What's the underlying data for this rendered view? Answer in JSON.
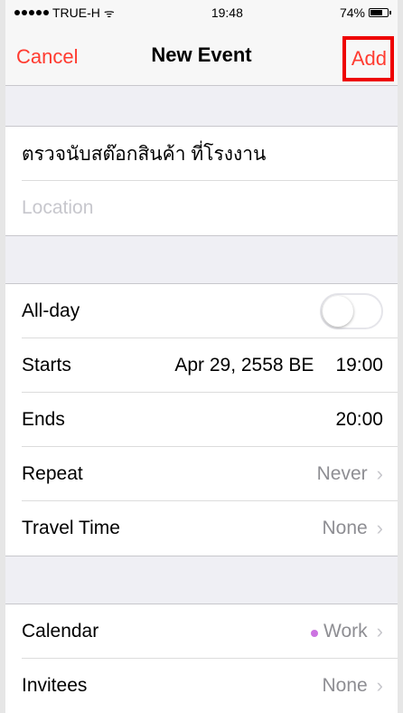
{
  "status": {
    "carrier": "TRUE-H",
    "time": "19:48",
    "battery": "74%",
    "battery_level": 0.74,
    "wifi_icon": "wifi-icon"
  },
  "nav": {
    "cancel": "Cancel",
    "title": "New Event",
    "add": "Add"
  },
  "event": {
    "title": "ตรวจนับสต๊อกสินค้า ที่โรงงาน",
    "location_placeholder": "Location"
  },
  "schedule": {
    "allday_label": "All-day",
    "allday_on": false,
    "starts_label": "Starts",
    "starts_date": "Apr 29, 2558 BE",
    "starts_time": "19:00",
    "ends_label": "Ends",
    "ends_time": "20:00",
    "repeat_label": "Repeat",
    "repeat_value": "Never",
    "travel_label": "Travel Time",
    "travel_value": "None"
  },
  "more": {
    "calendar_label": "Calendar",
    "calendar_value": "Work",
    "calendar_color": "#cc73e1",
    "invitees_label": "Invitees",
    "invitees_value": "None"
  },
  "colors": {
    "accent": "#ff3b30",
    "highlight": "#ee0000"
  }
}
